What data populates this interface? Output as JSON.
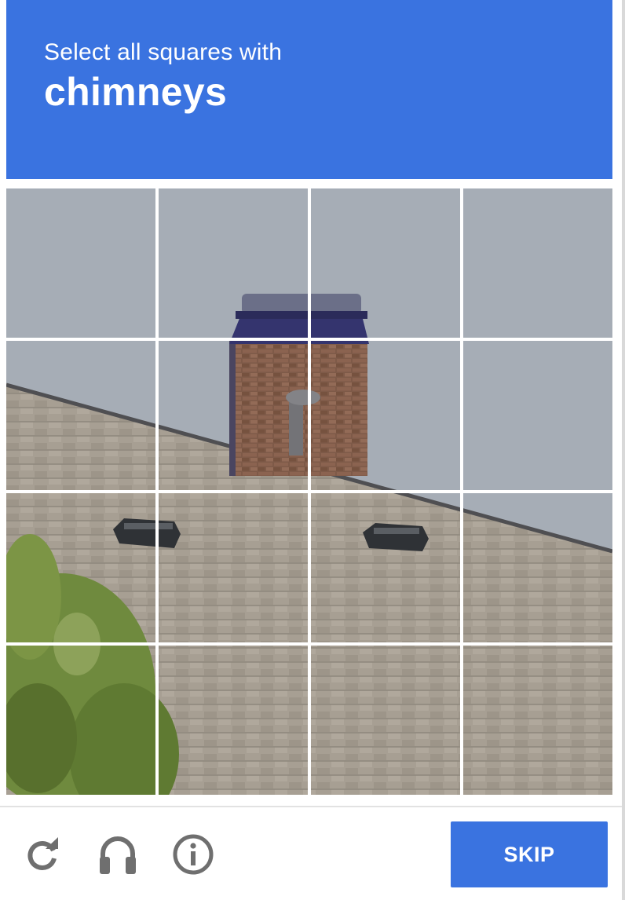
{
  "challenge": {
    "instruction": "Select all squares with",
    "target": "chimneys",
    "grid": {
      "rows": 4,
      "cols": 4,
      "tiles": [
        {
          "row": 1,
          "col": 1
        },
        {
          "row": 1,
          "col": 2
        },
        {
          "row": 1,
          "col": 3
        },
        {
          "row": 1,
          "col": 4
        },
        {
          "row": 2,
          "col": 1
        },
        {
          "row": 2,
          "col": 2
        },
        {
          "row": 2,
          "col": 3
        },
        {
          "row": 2,
          "col": 4
        },
        {
          "row": 3,
          "col": 1
        },
        {
          "row": 3,
          "col": 2
        },
        {
          "row": 3,
          "col": 3
        },
        {
          "row": 3,
          "col": 4
        },
        {
          "row": 4,
          "col": 1
        },
        {
          "row": 4,
          "col": 2
        },
        {
          "row": 4,
          "col": 3
        },
        {
          "row": 4,
          "col": 4
        }
      ]
    }
  },
  "footer": {
    "reload_icon": "reload-icon",
    "audio_icon": "headphones-icon",
    "info_icon": "info-icon",
    "skip_label": "SKIP"
  },
  "colors": {
    "accent": "#3a73e0",
    "icon_gray": "#6f6f6f",
    "sky": "#a6adb6",
    "roof": "#a79f93",
    "brick": "#7e5a48",
    "foliage": "#6f8a3e"
  }
}
